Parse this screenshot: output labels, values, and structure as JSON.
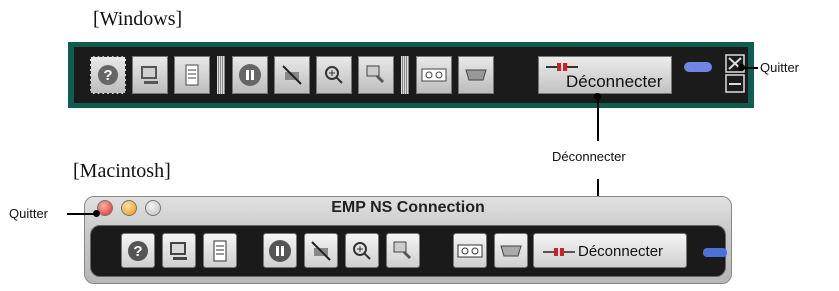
{
  "windows": {
    "section_label": "[Windows]",
    "disconnect_label": "Déconnecter"
  },
  "mac": {
    "section_label": "[Macintosh]",
    "window_title": "EMP NS Connection",
    "disconnect_label": "Déconnecter"
  },
  "callouts": {
    "quit_windows": "Quitter",
    "disconnect": "Déconnecter",
    "quit_mac": "Quitter"
  },
  "icons": {
    "toolbar": [
      "help-icon",
      "monitor-icon",
      "document-icon",
      "pause-icon",
      "no-cable-icon",
      "zoom-icon",
      "tools-icon",
      "tape-icon",
      "serial-icon",
      "plug-icon"
    ]
  },
  "colors": {
    "windows_frame": "#0f5d4e",
    "toolbar_bg": "#1b1b1b",
    "led_blue": "#6f84e3"
  }
}
